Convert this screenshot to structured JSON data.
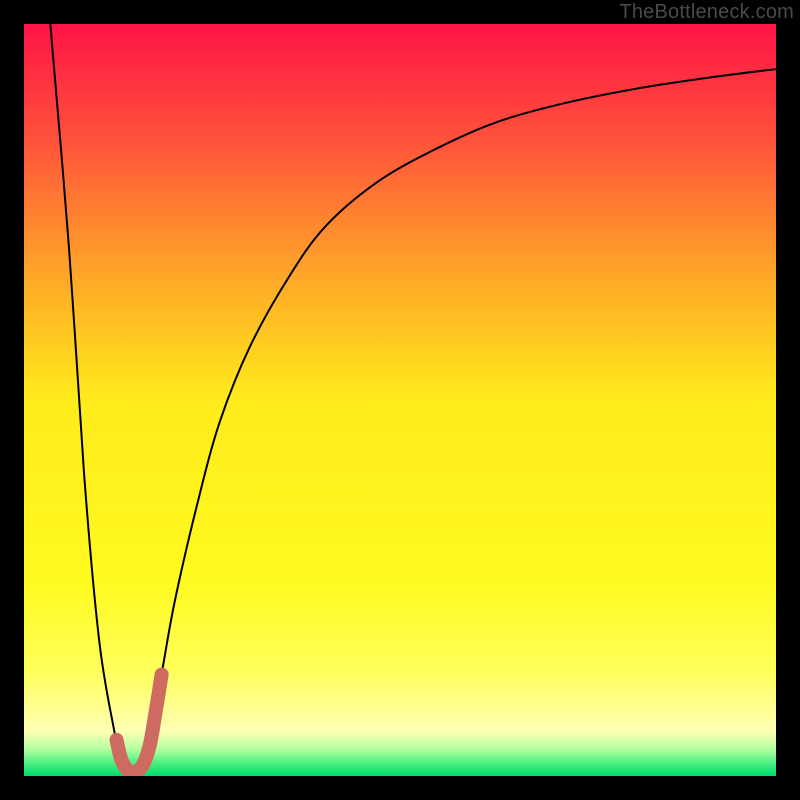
{
  "watermark": "TheBottleneck.com",
  "chart_data": {
    "type": "line",
    "title": "",
    "xlabel": "",
    "ylabel": "",
    "xlim": [
      0,
      100
    ],
    "ylim": [
      0,
      100
    ],
    "grid": false,
    "legend": false,
    "background_gradient_meaning": "vertical position encodes bottleneck severity: top=red=high, bottom=green=none",
    "series": [
      {
        "name": "bottleneck-curve",
        "stroke": "#000000",
        "stroke_width": 2,
        "x": [
          3.5,
          6,
          8,
          10,
          12,
          13,
          14.5,
          16,
          18,
          20,
          23,
          26,
          30,
          35,
          40,
          47,
          55,
          63,
          72,
          82,
          92,
          100
        ],
        "y": [
          100,
          70,
          40,
          18,
          6,
          1.5,
          0.5,
          3,
          12,
          23,
          36,
          47,
          57,
          66,
          73,
          79,
          83.5,
          87,
          89.5,
          91.5,
          93,
          94
        ]
      },
      {
        "name": "highlight-catenary",
        "stroke": "#cf6a61",
        "stroke_width": 14,
        "linecap": "round",
        "x": [
          12.3,
          12.9,
          13.6,
          14.5,
          15.7,
          16.7,
          17.5,
          18.3
        ],
        "y": [
          4.8,
          2.3,
          1.0,
          0.5,
          1.3,
          4.0,
          8.5,
          13.5
        ]
      }
    ]
  }
}
